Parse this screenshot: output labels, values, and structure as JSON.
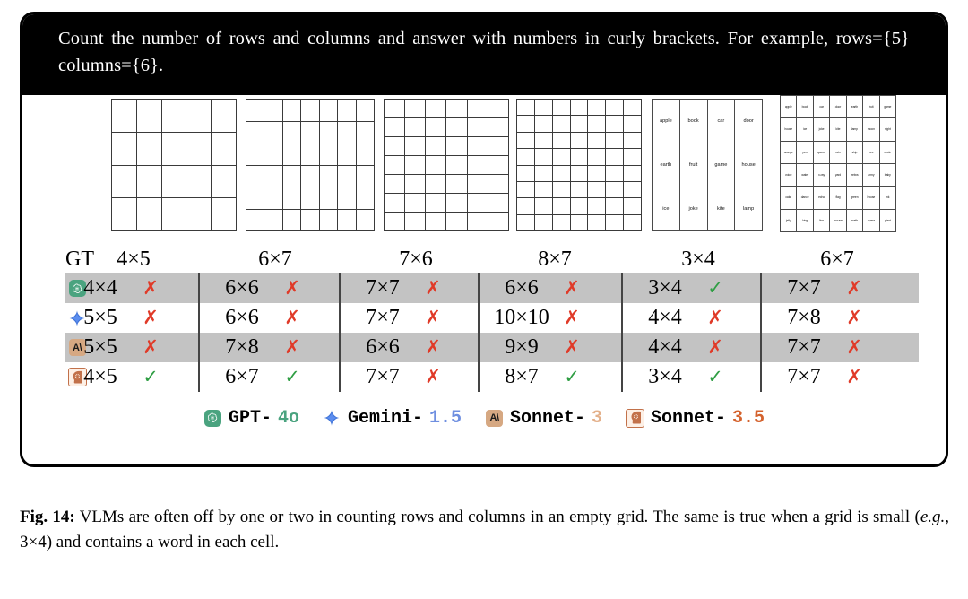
{
  "prompt": {
    "text": "Count the number of rows and columns and answer with numbers in curly brackets. For example, rows={5} columns={6}."
  },
  "grids": [
    {
      "name": "empty-grid-1",
      "rows": 4,
      "cols": 5,
      "gt": "4×5",
      "words": []
    },
    {
      "name": "empty-grid-2",
      "rows": 6,
      "cols": 7,
      "gt": "6×7",
      "words": []
    },
    {
      "name": "empty-grid-3",
      "rows": 7,
      "cols": 6,
      "gt": "7×6",
      "words": []
    },
    {
      "name": "empty-grid-4",
      "rows": 8,
      "cols": 7,
      "gt": "8×7",
      "words": []
    },
    {
      "name": "word-grid-5",
      "rows": 3,
      "cols": 4,
      "gt": "3×4",
      "words": [
        "apple",
        "book",
        "car",
        "door",
        "earth",
        "fruit",
        "game",
        "house",
        "ice",
        "joke",
        "kite",
        "lamp"
      ]
    },
    {
      "name": "word-grid-6",
      "rows": 6,
      "cols": 7,
      "gt": "6×7",
      "words": [
        "apple",
        "book",
        "car",
        "door",
        "earth",
        "fruit",
        "game",
        "house",
        "ice",
        "joke",
        "kite",
        "lamp",
        "moon",
        "night",
        "orange",
        "pen",
        "queen",
        "rain",
        "ship",
        "tree",
        "uncle",
        "voice",
        "water",
        "x-ray",
        "yard",
        "zebra",
        "army",
        "baby",
        "cake",
        "dance",
        "echo",
        "flag",
        "green",
        "house",
        "ink",
        "jelly",
        "king",
        "lion",
        "mouse",
        "north",
        "opera",
        "plant"
      ]
    }
  ],
  "table": {
    "gt_label": "GT",
    "gt_values": [
      "4×5",
      "6×7",
      "7×6",
      "8×7",
      "3×4",
      "6×7"
    ],
    "rows": [
      {
        "model": "GPT-4o",
        "icon": "gpt-icon",
        "shaded": true,
        "answers": [
          "4×4",
          "6×6",
          "7×7",
          "6×6",
          "3×4",
          "7×7"
        ],
        "marks": [
          "wrong",
          "wrong",
          "wrong",
          "wrong",
          "right",
          "wrong"
        ]
      },
      {
        "model": "Gemini-1.5",
        "icon": "gemini-icon",
        "shaded": false,
        "answers": [
          "5×5",
          "6×6",
          "7×7",
          "10×10",
          "4×4",
          "7×8"
        ],
        "marks": [
          "wrong",
          "wrong",
          "wrong",
          "wrong",
          "wrong",
          "wrong"
        ]
      },
      {
        "model": "Sonnet-3",
        "icon": "sonnet3-icon",
        "shaded": true,
        "answers": [
          "5×5",
          "7×8",
          "6×6",
          "9×9",
          "4×4",
          "7×7"
        ],
        "marks": [
          "wrong",
          "wrong",
          "wrong",
          "wrong",
          "wrong",
          "wrong"
        ]
      },
      {
        "model": "Sonnet-3.5",
        "icon": "sonnet35-icon",
        "shaded": false,
        "answers": [
          "4×5",
          "6×7",
          "7×7",
          "8×7",
          "3×4",
          "7×7"
        ],
        "marks": [
          "right",
          "right",
          "wrong",
          "right",
          "right",
          "wrong"
        ]
      }
    ],
    "mark_glyphs": {
      "wrong": "✗",
      "right": "✓"
    },
    "mark_colors": {
      "wrong": "#e03a28",
      "right": "#2f9e44"
    },
    "row_shade_color": "#c3c3c3"
  },
  "legend": [
    {
      "icon": "gpt-icon",
      "name": "GPT-",
      "version": "4o",
      "color": "#4aa37f"
    },
    {
      "icon": "gemini-icon",
      "name": "Gemini-",
      "version": "1.5",
      "color": "#6f8fe0"
    },
    {
      "icon": "sonnet3-icon",
      "name": "Sonnet-",
      "version": "3",
      "color": "#e3b08a"
    },
    {
      "icon": "sonnet35-icon",
      "name": "Sonnet-",
      "version": "3.5",
      "color": "#d4622d"
    }
  ],
  "caption": {
    "figure_label": "Fig. 14:",
    "part1": " VLMs are often off by one or two in counting rows and columns in an empty grid. The same is true when a grid is small (",
    "emphasis": "e.g.",
    "part2": ", 3×4) and contains a word in each cell."
  }
}
